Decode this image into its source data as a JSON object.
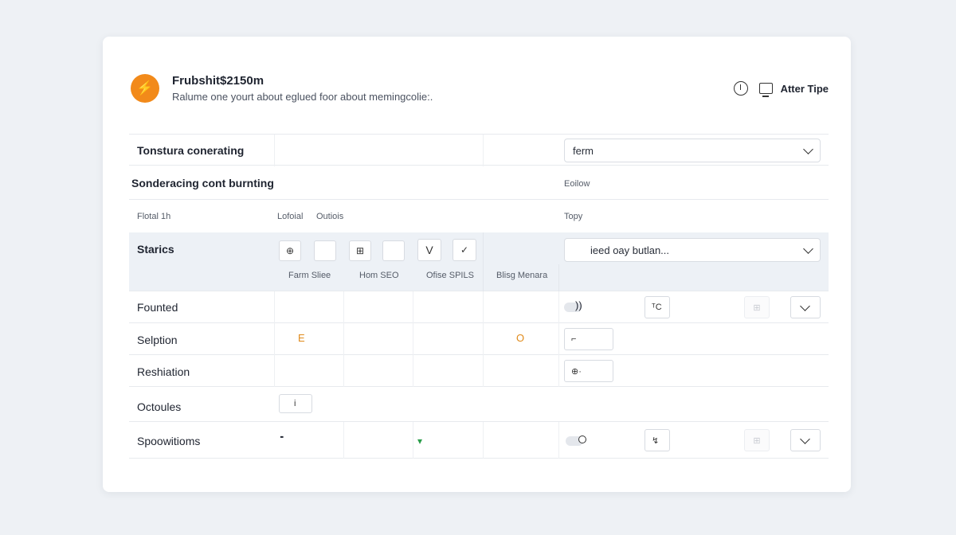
{
  "header": {
    "logo_glyph": "⚡",
    "title": "Frubshit$2150m",
    "subtitle": "Ralume one yourt about eglued foor about memingcolie:.",
    "right_label": "Atter Tipe",
    "accent_color": "#f28a1a"
  },
  "rows": {
    "r1": {
      "label": "Tonstura conerating",
      "select_value": "ferm"
    },
    "r2": {
      "label": "Sonderacing cont burnting",
      "right_text": "Eoilow"
    },
    "r3": {
      "col1": "Flotal 1h",
      "col2a": "Lofoial",
      "col2b": "Outiois",
      "right_text": "Topy"
    },
    "r4": {
      "label": "Starics",
      "btn1_glyph": "⊕",
      "btn3_glyph": "⊞",
      "btn5_glyph": "V",
      "btn6_glyph": "✓",
      "col_a": "Farm Sliee",
      "col_b": "Hom SEO",
      "col_c": "Ofise SPILS",
      "col_d": "Blisg Menara",
      "select_value": "ieed oay butlan..."
    },
    "r5": {
      "label": "Founted",
      "toggle_text": "))",
      "btn_text": "ᵀC",
      "faded_glyph": "⊞"
    },
    "r6": {
      "label": "Selption",
      "mark_a": "E",
      "mark_b": "O",
      "input_text": "⌐",
      "marker_color": "#e08a1a"
    },
    "r7": {
      "label": "Reshiation",
      "input_text": "⊕·"
    },
    "r8": {
      "label": "Octoules",
      "input_text": "i"
    },
    "r9": {
      "label": "Spoowitioms",
      "mark_a": "╸",
      "mark_b": "▾",
      "btn_text": "↯",
      "faded_glyph": "⊞",
      "marker_color": "#2a9d4a"
    }
  }
}
